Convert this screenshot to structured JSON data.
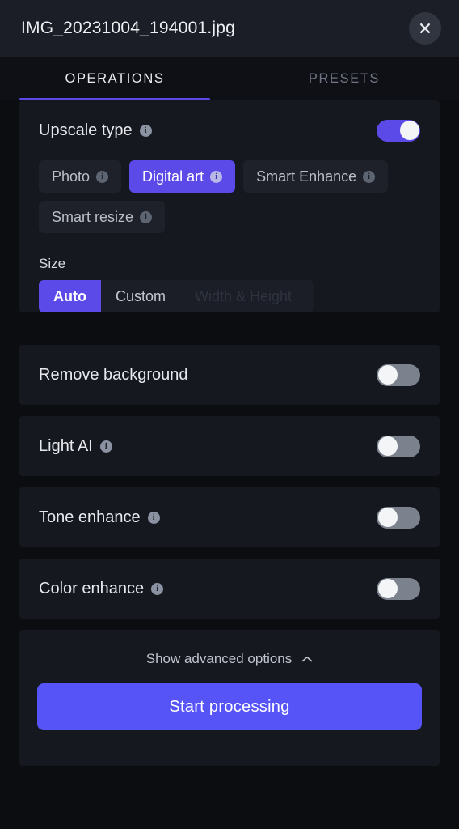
{
  "header": {
    "file_name": "IMG_20231004_194001.jpg",
    "close_icon": "close-icon"
  },
  "tabs": [
    {
      "label": "OPERATIONS",
      "active": true
    },
    {
      "label": "PRESETS",
      "active": false
    }
  ],
  "upscale": {
    "title": "Upscale type",
    "info_icon": "info-icon",
    "toggle_on": true,
    "chips": [
      {
        "label": "Photo",
        "selected": false,
        "info": true
      },
      {
        "label": "Digital art",
        "selected": true,
        "info": true
      },
      {
        "label": "Smart Enhance",
        "selected": false,
        "info": true
      },
      {
        "label": "Smart resize",
        "selected": false,
        "info": true
      }
    ],
    "size": {
      "label": "Size",
      "options": [
        {
          "label": "Auto",
          "selected": true,
          "disabled": false
        },
        {
          "label": "Custom",
          "selected": false,
          "disabled": false
        },
        {
          "label": "Width & Height",
          "selected": false,
          "disabled": true
        }
      ]
    }
  },
  "toggles": [
    {
      "label": "Remove background",
      "info": false,
      "on": false
    },
    {
      "label": "Light AI",
      "info": true,
      "on": false
    },
    {
      "label": "Tone enhance",
      "info": true,
      "on": false
    },
    {
      "label": "Color enhance",
      "info": true,
      "on": false
    }
  ],
  "footer": {
    "advanced_label": "Show advanced options",
    "chevron_icon": "chevron-up-icon",
    "cta_label": "Start processing"
  },
  "colors": {
    "accent": "#5b4ae8",
    "cta": "#5754f7",
    "card": "#16181f",
    "background": "#0b0d11"
  }
}
